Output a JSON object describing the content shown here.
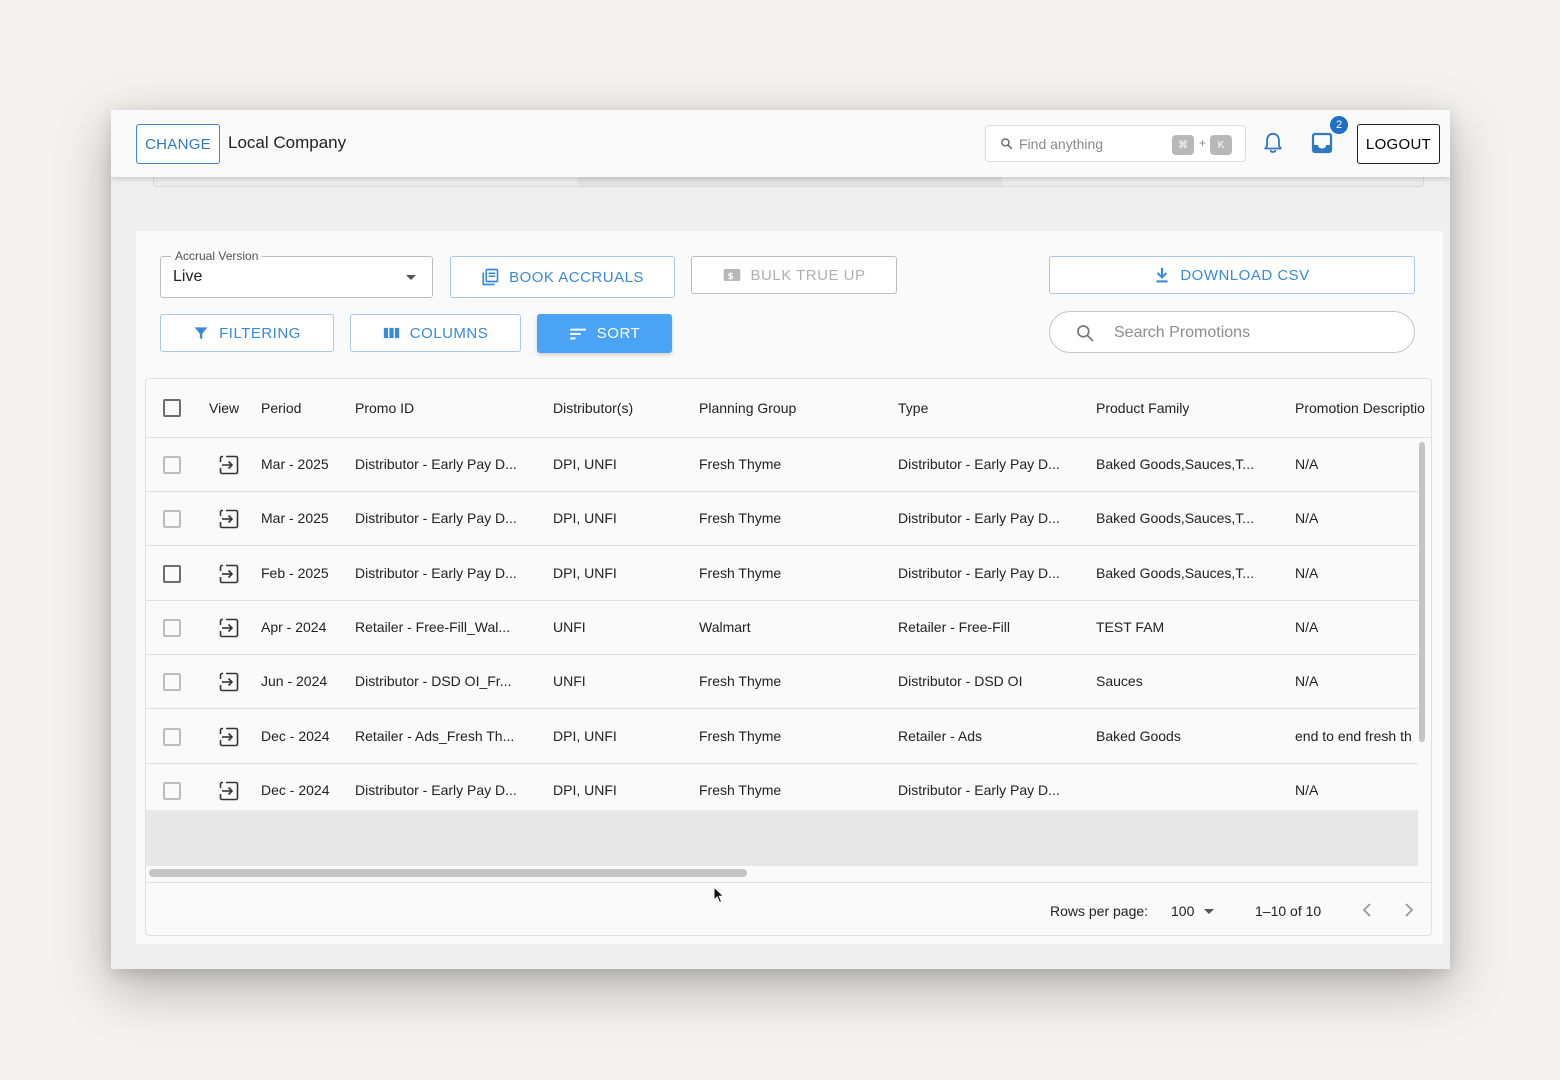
{
  "header": {
    "change_label": "CHANGE",
    "company": "Local Company",
    "search_placeholder": "Find anything",
    "shortcut_key1": "⌘",
    "shortcut_plus": "+",
    "shortcut_key2": "K",
    "notification_count": "2",
    "logout_label": "LOGOUT",
    "icons": [
      "search-icon",
      "bell-icon",
      "inbox-icon"
    ]
  },
  "toolbar": {
    "accrual_label": "Accrual Version",
    "accrual_value": "Live",
    "book_accruals": "BOOK ACCRUALS",
    "bulk_true_up": "BULK TRUE UP",
    "download_csv": "DOWNLOAD CSV",
    "filtering": "FILTERING",
    "columns": "COLUMNS",
    "sort": "SORT",
    "search_placeholder": "Search Promotions"
  },
  "colors": {
    "primary": "#3a8ad8",
    "primary_filled": "#4aa3f4",
    "badge": "#1f6fc5"
  },
  "table": {
    "columns": [
      "View",
      "Period",
      "Promo ID",
      "Distributor(s)",
      "Planning Group",
      "Type",
      "Product Family",
      "Promotion Descriptio"
    ],
    "rows": [
      {
        "period": "Mar - 2025",
        "promo_id": "Distributor - Early Pay D...",
        "distributors": "DPI, UNFI",
        "planning_group": "Fresh Thyme",
        "type": "Distributor - Early Pay D...",
        "product_family": "Baked Goods,Sauces,T...",
        "description": "N/A"
      },
      {
        "period": "Mar - 2025",
        "promo_id": "Distributor - Early Pay D...",
        "distributors": "DPI, UNFI",
        "planning_group": "Fresh Thyme",
        "type": "Distributor - Early Pay D...",
        "product_family": "Baked Goods,Sauces,T...",
        "description": "N/A"
      },
      {
        "period": "Feb - 2025",
        "promo_id": "Distributor - Early Pay D...",
        "distributors": "DPI, UNFI",
        "planning_group": "Fresh Thyme",
        "type": "Distributor - Early Pay D...",
        "product_family": "Baked Goods,Sauces,T...",
        "description": "N/A"
      },
      {
        "period": "Apr - 2024",
        "promo_id": "Retailer - Free-Fill_Wal...",
        "distributors": "UNFI",
        "planning_group": "Walmart",
        "type": "Retailer - Free-Fill",
        "product_family": "TEST FAM",
        "description": "N/A"
      },
      {
        "period": "Jun - 2024",
        "promo_id": "Distributor - DSD OI_Fr...",
        "distributors": "UNFI",
        "planning_group": "Fresh Thyme",
        "type": "Distributor - DSD OI",
        "product_family": "Sauces",
        "description": "N/A"
      },
      {
        "period": "Dec - 2024",
        "promo_id": "Retailer - Ads_Fresh Th...",
        "distributors": "DPI, UNFI",
        "planning_group": "Fresh Thyme",
        "type": "Retailer - Ads",
        "product_family": "Baked Goods",
        "description": "end to end fresh th"
      },
      {
        "period": "Dec - 2024",
        "promo_id": "Distributor - Early Pay D...",
        "distributors": "DPI, UNFI",
        "planning_group": "Fresh Thyme",
        "type": "Distributor - Early Pay D...",
        "product_family": "",
        "description": "N/A"
      }
    ]
  },
  "footer": {
    "rows_per_page_label": "Rows per page:",
    "rows_per_page_value": "100",
    "range": "1–10 of 10"
  }
}
